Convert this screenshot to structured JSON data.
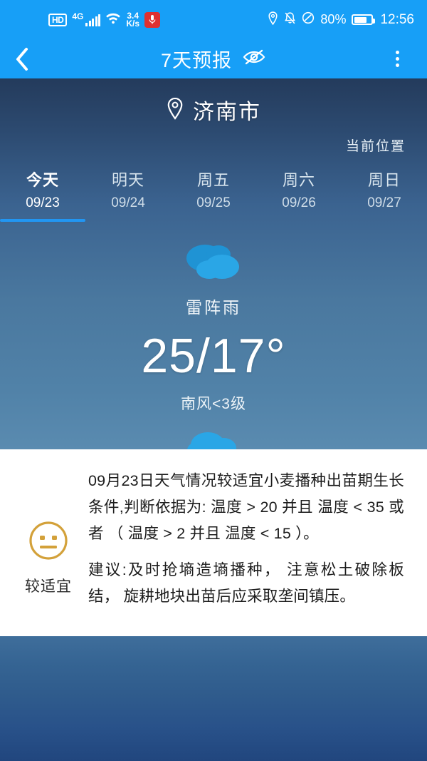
{
  "statusbar": {
    "hd_label": "HD",
    "network_type": "4G",
    "data_rate": "3.4",
    "data_rate_unit": "K/s",
    "mic_icon": "microphone-icon",
    "location_icon": "location-pin-icon",
    "mute_icon": "bell-muted-icon",
    "dnd_icon": "do-not-disturb-icon",
    "battery_percent": "80%",
    "clock": "12:56"
  },
  "appbar": {
    "back_icon": "back-chevron-icon",
    "title": "7天预报",
    "visibility_icon": "eye-slash-icon",
    "menu_icon": "overflow-menu-icon"
  },
  "hero": {
    "location_icon": "location-pin-icon",
    "city": "济南市",
    "current_location_label": "当前位置",
    "tabs": [
      {
        "day": "今天",
        "date": "09/23",
        "active": true
      },
      {
        "day": "明天",
        "date": "09/24",
        "active": false
      },
      {
        "day": "周五",
        "date": "09/25",
        "active": false
      },
      {
        "day": "周六",
        "date": "09/26",
        "active": false
      },
      {
        "day": "周日",
        "date": "09/27",
        "active": false
      }
    ],
    "condition_icon": "cloudy-icon",
    "condition": "雷阵雨",
    "temperature": "25/17°",
    "wind": "南风<3级",
    "forecast_icon": "thunderstorm-rain-icon",
    "accent_color": "#2196f3"
  },
  "advisory": {
    "face_icon": "neutral-face-icon",
    "rating_label": "较适宜",
    "rating_color": "#d3a13a",
    "paragraph_1": "09月23日天气情况较适宜小麦播种出苗期生长条件,判断依据为: 温度 > 20  并且  温度 < 35  或者 （ 温度 > 2  并且  温度 < 15 ）。",
    "paragraph_2": "建议:及时抢墒造墒播种， 注意松土破除板结， 旋耕地块出苗后应采取垄间镇压。"
  }
}
